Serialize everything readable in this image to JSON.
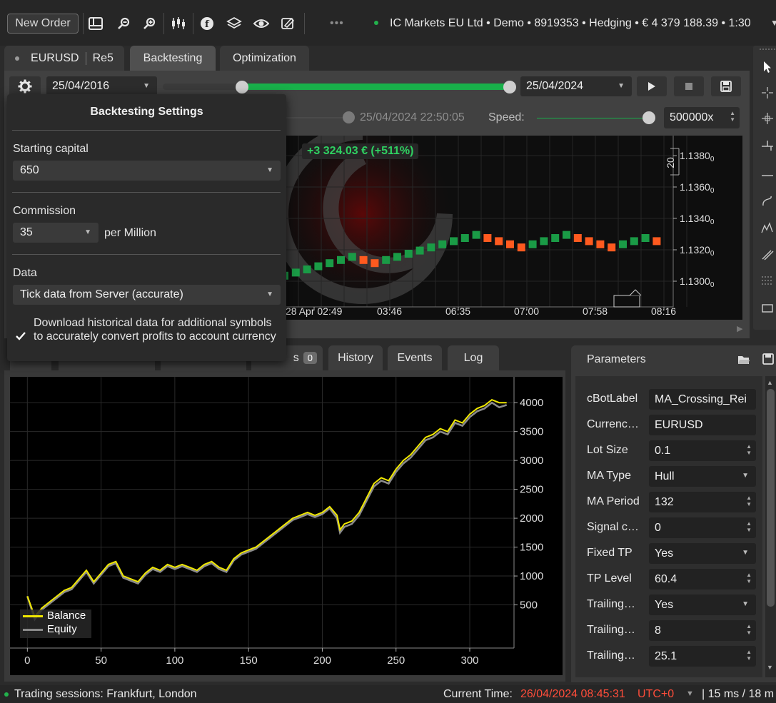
{
  "toolbar": {
    "new_order": "New Order",
    "account_info": "IC Markets EU Ltd • Demo • 8919353 • Hedging • € 4 379 188.39 • 1:30"
  },
  "tabs": {
    "symbol": "EURUSD",
    "robot": "Re5",
    "backtesting": "Backtesting",
    "optimization": "Optimization"
  },
  "controls": {
    "start_date": "25/04/2016",
    "end_date": "25/04/2024",
    "current_time": "25/04/2024 22:50:05",
    "speed_label": "Speed:",
    "speed_value": "500000x",
    "progress_fraction": 1.0
  },
  "popup": {
    "title": "Backtesting Settings",
    "starting_capital_label": "Starting capital",
    "starting_capital_value": "650",
    "commission_label": "Commission",
    "commission_value": "35",
    "commission_unit": "per Million",
    "data_label": "Data",
    "data_value": "Tick data from Server (accurate)",
    "download_label": "Download historical data for additional symbols to accurately convert profits to account currency",
    "download_checked": true
  },
  "price_chart": {
    "pnl_badge": "+3 324.03 € (+511%)",
    "y_labels": [
      "1.1380",
      "1.1360",
      "1.1340",
      "1.1320",
      "1.1300"
    ],
    "y_subscript": "0",
    "x_labels": [
      "28 Apr 02:49",
      "03:46",
      "06:35",
      "07:00",
      "07:58",
      "08:16"
    ],
    "period_label": "20",
    "bullish_color": "#1a9b46",
    "bearish_color": "#ff5a1f",
    "bricks": [
      {
        "x": 0,
        "y": 1.13035,
        "dir": "up"
      },
      {
        "x": 1,
        "y": 1.13055,
        "dir": "up"
      },
      {
        "x": 2,
        "y": 1.13075,
        "dir": "up"
      },
      {
        "x": 3,
        "y": 1.13095,
        "dir": "up"
      },
      {
        "x": 4,
        "y": 1.13115,
        "dir": "up"
      },
      {
        "x": 5,
        "y": 1.13135,
        "dir": "up"
      },
      {
        "x": 6,
        "y": 1.13155,
        "dir": "up"
      },
      {
        "x": 7,
        "y": 1.13135,
        "dir": "down"
      },
      {
        "x": 8,
        "y": 1.13115,
        "dir": "down"
      },
      {
        "x": 9,
        "y": 1.13135,
        "dir": "up"
      },
      {
        "x": 10,
        "y": 1.13155,
        "dir": "up"
      },
      {
        "x": 11,
        "y": 1.13175,
        "dir": "up"
      },
      {
        "x": 12,
        "y": 1.13195,
        "dir": "up"
      },
      {
        "x": 13,
        "y": 1.13215,
        "dir": "up"
      },
      {
        "x": 14,
        "y": 1.13235,
        "dir": "up"
      },
      {
        "x": 15,
        "y": 1.13255,
        "dir": "up"
      },
      {
        "x": 16,
        "y": 1.13275,
        "dir": "up"
      },
      {
        "x": 17,
        "y": 1.13295,
        "dir": "up"
      },
      {
        "x": 18,
        "y": 1.13275,
        "dir": "down"
      },
      {
        "x": 19,
        "y": 1.13255,
        "dir": "down"
      },
      {
        "x": 20,
        "y": 1.13235,
        "dir": "down"
      },
      {
        "x": 21,
        "y": 1.13215,
        "dir": "down"
      },
      {
        "x": 22,
        "y": 1.13235,
        "dir": "up"
      },
      {
        "x": 23,
        "y": 1.13255,
        "dir": "up"
      },
      {
        "x": 24,
        "y": 1.13275,
        "dir": "up"
      },
      {
        "x": 25,
        "y": 1.13295,
        "dir": "up"
      },
      {
        "x": 26,
        "y": 1.13275,
        "dir": "down"
      },
      {
        "x": 27,
        "y": 1.13255,
        "dir": "down"
      },
      {
        "x": 28,
        "y": 1.13235,
        "dir": "down"
      },
      {
        "x": 29,
        "y": 1.13215,
        "dir": "down"
      },
      {
        "x": 30,
        "y": 1.13235,
        "dir": "up"
      },
      {
        "x": 31,
        "y": 1.13255,
        "dir": "up"
      },
      {
        "x": 32,
        "y": 1.13275,
        "dir": "up"
      },
      {
        "x": 33,
        "y": 1.13255,
        "dir": "down"
      }
    ]
  },
  "bottom_tabs": {
    "orders_suffix": "s",
    "orders_count": "0",
    "history": "History",
    "events": "Events",
    "log": "Log"
  },
  "chart_data": {
    "type": "line",
    "x_ticks": [
      "0",
      "50",
      "100",
      "150",
      "200",
      "250",
      "300"
    ],
    "y_ticks": [
      "4000",
      "3500",
      "3000",
      "2500",
      "2000",
      "1500",
      "1000",
      "500"
    ],
    "xlim": [
      -5,
      330
    ],
    "ylim": [
      0,
      4200
    ],
    "series": [
      {
        "name": "Balance",
        "color": "#f0e800",
        "x": [
          0,
          5,
          10,
          15,
          20,
          25,
          30,
          35,
          40,
          45,
          50,
          55,
          60,
          65,
          70,
          75,
          80,
          85,
          90,
          95,
          100,
          105,
          110,
          115,
          120,
          125,
          130,
          135,
          140,
          145,
          150,
          155,
          160,
          165,
          170,
          175,
          180,
          185,
          190,
          195,
          200,
          205,
          210,
          212,
          215,
          220,
          225,
          230,
          235,
          240,
          245,
          250,
          255,
          260,
          265,
          270,
          275,
          280,
          285,
          290,
          295,
          300,
          305,
          310,
          315,
          320,
          325
        ],
        "values": [
          650,
          300,
          450,
          550,
          650,
          750,
          800,
          950,
          1100,
          900,
          1050,
          1200,
          1250,
          1000,
          950,
          900,
          1050,
          1150,
          1100,
          1200,
          1150,
          1200,
          1150,
          1100,
          1200,
          1250,
          1150,
          1100,
          1300,
          1400,
          1450,
          1500,
          1600,
          1700,
          1800,
          1900,
          2000,
          2050,
          2100,
          2050,
          2100,
          2200,
          2050,
          1800,
          1900,
          1950,
          2100,
          2350,
          2600,
          2700,
          2650,
          2850,
          3000,
          3100,
          3250,
          3400,
          3450,
          3550,
          3500,
          3700,
          3650,
          3800,
          3900,
          3950,
          4050,
          4000,
          4000
        ]
      },
      {
        "name": "Equity",
        "color": "#8a8a8a",
        "x": [
          0,
          5,
          10,
          15,
          20,
          25,
          30,
          35,
          40,
          45,
          50,
          55,
          60,
          65,
          70,
          75,
          80,
          85,
          90,
          95,
          100,
          105,
          110,
          115,
          120,
          125,
          130,
          135,
          140,
          145,
          150,
          155,
          160,
          165,
          170,
          175,
          180,
          185,
          190,
          195,
          200,
          205,
          210,
          212,
          215,
          220,
          225,
          230,
          235,
          240,
          245,
          250,
          255,
          260,
          265,
          270,
          275,
          280,
          285,
          290,
          295,
          300,
          305,
          310,
          315,
          320,
          325
        ],
        "values": [
          650,
          250,
          420,
          520,
          620,
          720,
          770,
          920,
          1070,
          870,
          1020,
          1170,
          1220,
          970,
          920,
          870,
          1020,
          1120,
          1070,
          1170,
          1120,
          1170,
          1120,
          1070,
          1170,
          1220,
          1120,
          1070,
          1270,
          1370,
          1420,
          1470,
          1570,
          1670,
          1770,
          1870,
          1970,
          2020,
          2070,
          2020,
          2070,
          2170,
          2000,
          1750,
          1850,
          1900,
          2050,
          2300,
          2550,
          2650,
          2600,
          2800,
          2950,
          3050,
          3200,
          3350,
          3400,
          3500,
          3450,
          3650,
          3600,
          3750,
          3850,
          3900,
          4000,
          3920,
          3960
        ]
      }
    ]
  },
  "parameters": {
    "title": "Parameters",
    "rows": [
      {
        "label": "cBotLabel",
        "value": "MA_Crossing_Rei",
        "control": "text"
      },
      {
        "label": "Currenc…",
        "value": "EURUSD",
        "control": "text"
      },
      {
        "label": "Lot Size",
        "value": "0.1",
        "control": "spin"
      },
      {
        "label": "MA Type",
        "value": "Hull",
        "control": "select"
      },
      {
        "label": "MA Period",
        "value": "132",
        "control": "spin"
      },
      {
        "label": "Signal c…",
        "value": "0",
        "control": "spin"
      },
      {
        "label": "Fixed TP",
        "value": "Yes",
        "control": "select"
      },
      {
        "label": "TP Level",
        "value": "60.4",
        "control": "spin"
      },
      {
        "label": "Trailing…",
        "value": "Yes",
        "control": "select"
      },
      {
        "label": "Trailing…",
        "value": "8",
        "control": "spin"
      },
      {
        "label": "Trailing…",
        "value": "25.1",
        "control": "spin"
      }
    ]
  },
  "status": {
    "sessions": "Trading sessions: Frankfurt, London",
    "current_time_label": "Current Time:",
    "current_time": "26/04/2024 08:45:31",
    "timezone": "UTC+0",
    "latency": "| 15 ms / 18 m",
    "time_color": "#ff4d3a"
  }
}
